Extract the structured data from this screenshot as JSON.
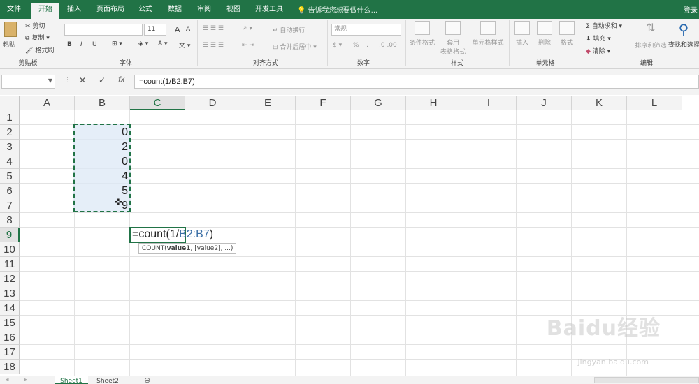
{
  "tabs": [
    "文件",
    "开始",
    "插入",
    "页面布局",
    "公式",
    "数据",
    "审阅",
    "视图",
    "开发工具"
  ],
  "tell_me": "告诉我您想要做什么...",
  "login": "登录",
  "ribbon": {
    "clipboard": {
      "paste": "粘贴",
      "cut": "剪切",
      "copy": "复制",
      "format_painter": "格式刷",
      "label": "剪贴板"
    },
    "font": {
      "size": "11",
      "bold": "B",
      "italic": "I",
      "underline": "U",
      "grow": "A",
      "shrink": "A",
      "label": "字体"
    },
    "alignment": {
      "wrap": "自动换行",
      "merge": "合并后居中",
      "label": "对齐方式"
    },
    "number": {
      "format": "常规",
      "percent": "%",
      "comma": ",",
      "label": "数字"
    },
    "styles": {
      "conditional": "条件格式",
      "table_line1": "套用",
      "table_line2": "表格格式",
      "cell_styles": "单元格样式",
      "label": "样式"
    },
    "cells": {
      "insert": "插入",
      "delete": "删除",
      "format": "格式",
      "label": "单元格"
    },
    "editing": {
      "autosum": "自动求和",
      "fill": "填充",
      "clear": "清除",
      "sort": "排序和筛选",
      "find": "查找和选择",
      "label": "编辑"
    }
  },
  "formula_bar": {
    "cancel": "✕",
    "enter": "✓",
    "fx": "fx",
    "content": "=count(1/B2:B7)"
  },
  "columns": [
    "A",
    "B",
    "C",
    "D",
    "E",
    "F",
    "G",
    "H",
    "I",
    "J",
    "K",
    "L"
  ],
  "rows": [
    "1",
    "2",
    "3",
    "4",
    "5",
    "6",
    "7",
    "8",
    "9",
    "10",
    "11",
    "12",
    "13",
    "14",
    "15",
    "16",
    "17",
    "18"
  ],
  "cells_b": [
    "0",
    "2",
    "0",
    "4",
    "5",
    "9"
  ],
  "edit_cell": {
    "prefix": "=count(1/",
    "ref": "B2:B7",
    "suffix": ")"
  },
  "tooltip": {
    "fn": "COUNT(",
    "arg1": "value1",
    "rest": ", [value2], ...)"
  },
  "sheets": [
    "Sheet1",
    "Sheet2"
  ],
  "watermark": {
    "brand": "Baidu经验",
    "url": "jingyan.baidu.com"
  },
  "colors": {
    "accent": "#217346",
    "ref_blue": "#3a6ea5",
    "marquee_fill": "#dce8f6"
  }
}
